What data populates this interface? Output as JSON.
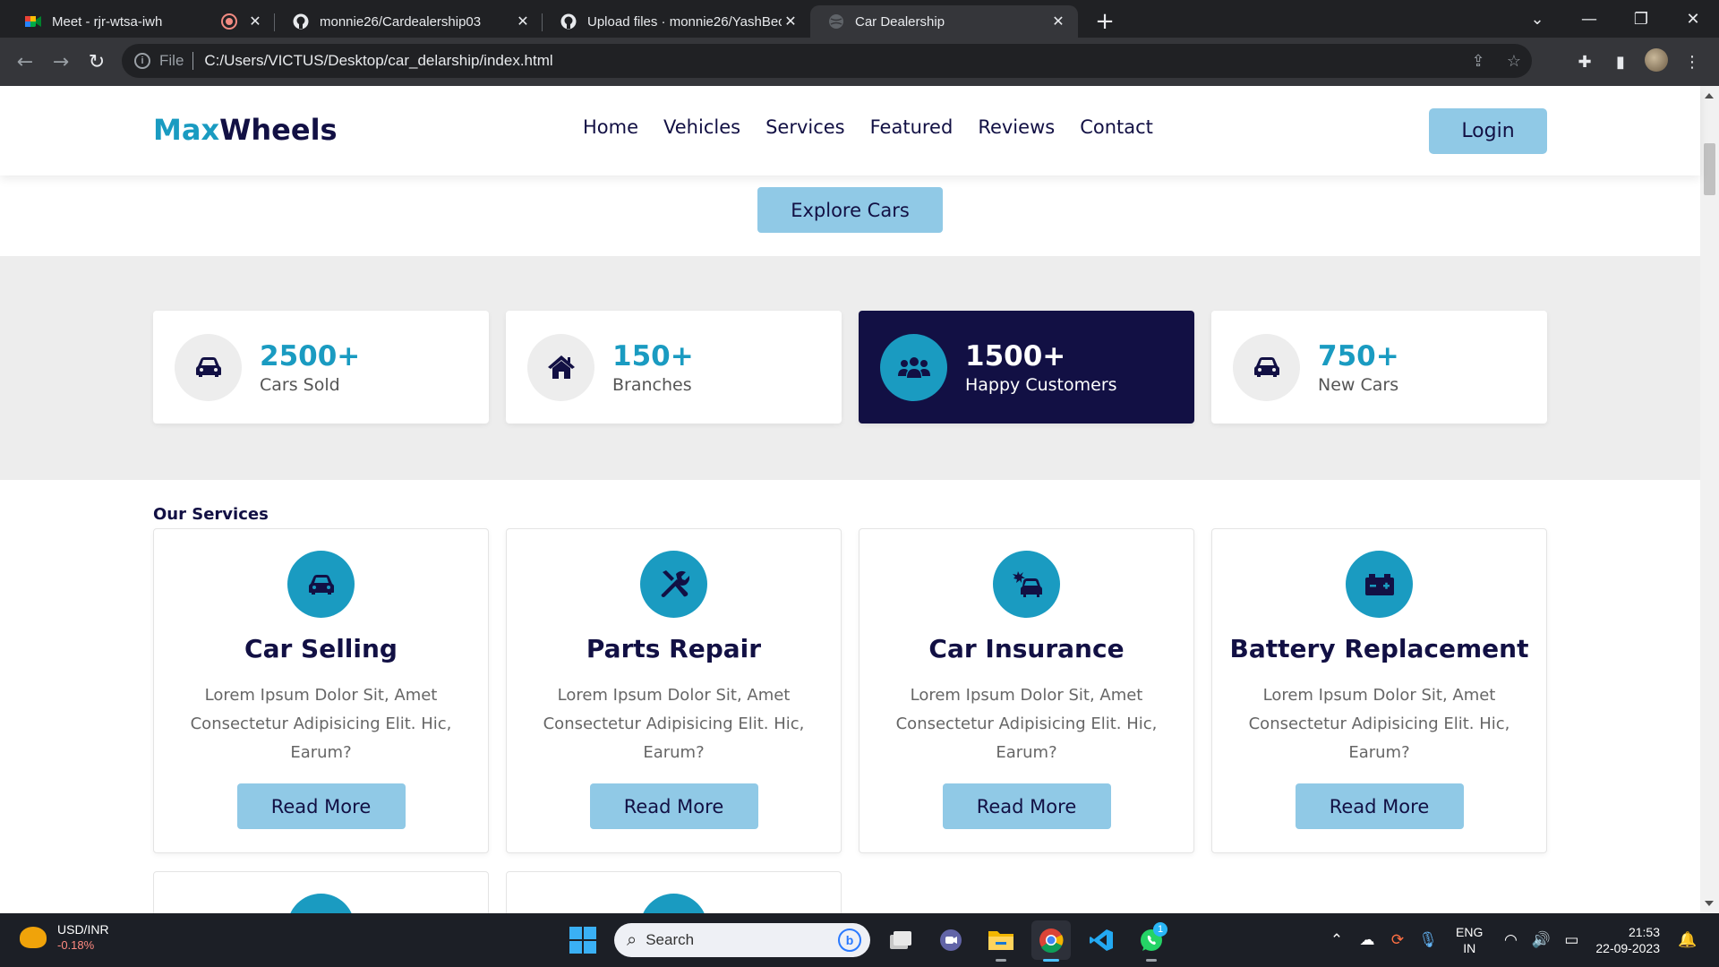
{
  "browser": {
    "tabs": [
      {
        "title": "Meet - rjr-wtsa-iwh",
        "icon": "google-meet-icon",
        "recording": true
      },
      {
        "title": "monnie26/Cardealership03",
        "icon": "github-icon"
      },
      {
        "title": "Upload files · monnie26/YashBec",
        "icon": "github-icon"
      },
      {
        "title": "Car Dealership",
        "icon": "globe-icon",
        "active": true
      }
    ],
    "address": {
      "scheme": "File",
      "url": "C:/Users/VICTUS/Desktop/car_delarship/index.html"
    }
  },
  "site": {
    "logo": {
      "part1": "Max",
      "part2": "Wheels"
    },
    "nav": [
      "Home",
      "Vehicles",
      "Services",
      "Featured",
      "Reviews",
      "Contact"
    ],
    "login": "Login",
    "explore": "Explore Cars",
    "stats": [
      {
        "number": "2500+",
        "label": "Cars Sold",
        "icon": "car-icon"
      },
      {
        "number": "150+",
        "label": "Branches",
        "icon": "home-icon"
      },
      {
        "number": "1500+",
        "label": "Happy Customers",
        "icon": "users-icon"
      },
      {
        "number": "750+",
        "label": "New Cars",
        "icon": "car-icon"
      }
    ],
    "services_title": "Our Services",
    "services": [
      {
        "title": "Car Selling",
        "desc": "Lorem Ipsum Dolor Sit, Amet Consectetur Adipisicing Elit. Hic, Earum?",
        "button": "Read More",
        "icon": "car-icon"
      },
      {
        "title": "Parts Repair",
        "desc": "Lorem Ipsum Dolor Sit, Amet Consectetur Adipisicing Elit. Hic, Earum?",
        "button": "Read More",
        "icon": "tools-icon"
      },
      {
        "title": "Car Insurance",
        "desc": "Lorem Ipsum Dolor Sit, Amet Consectetur Adipisicing Elit. Hic, Earum?",
        "button": "Read More",
        "icon": "car-crash-icon"
      },
      {
        "title": "Battery Replacement",
        "desc": "Lorem Ipsum Dolor Sit, Amet Consectetur Adipisicing Elit. Hic, Earum?",
        "button": "Read More",
        "icon": "battery-icon"
      }
    ]
  },
  "taskbar": {
    "ticker": {
      "symbol": "USD/INR",
      "change": "-0.18%"
    },
    "search_placeholder": "Search",
    "lang": {
      "line1": "ENG",
      "line2": "IN"
    },
    "clock": {
      "time": "21:53",
      "date": "22-09-2023"
    },
    "whatsapp_badge": "1"
  },
  "colors": {
    "brand": "#1a9bc1",
    "navy": "#121044",
    "button": "#90c9e6"
  }
}
